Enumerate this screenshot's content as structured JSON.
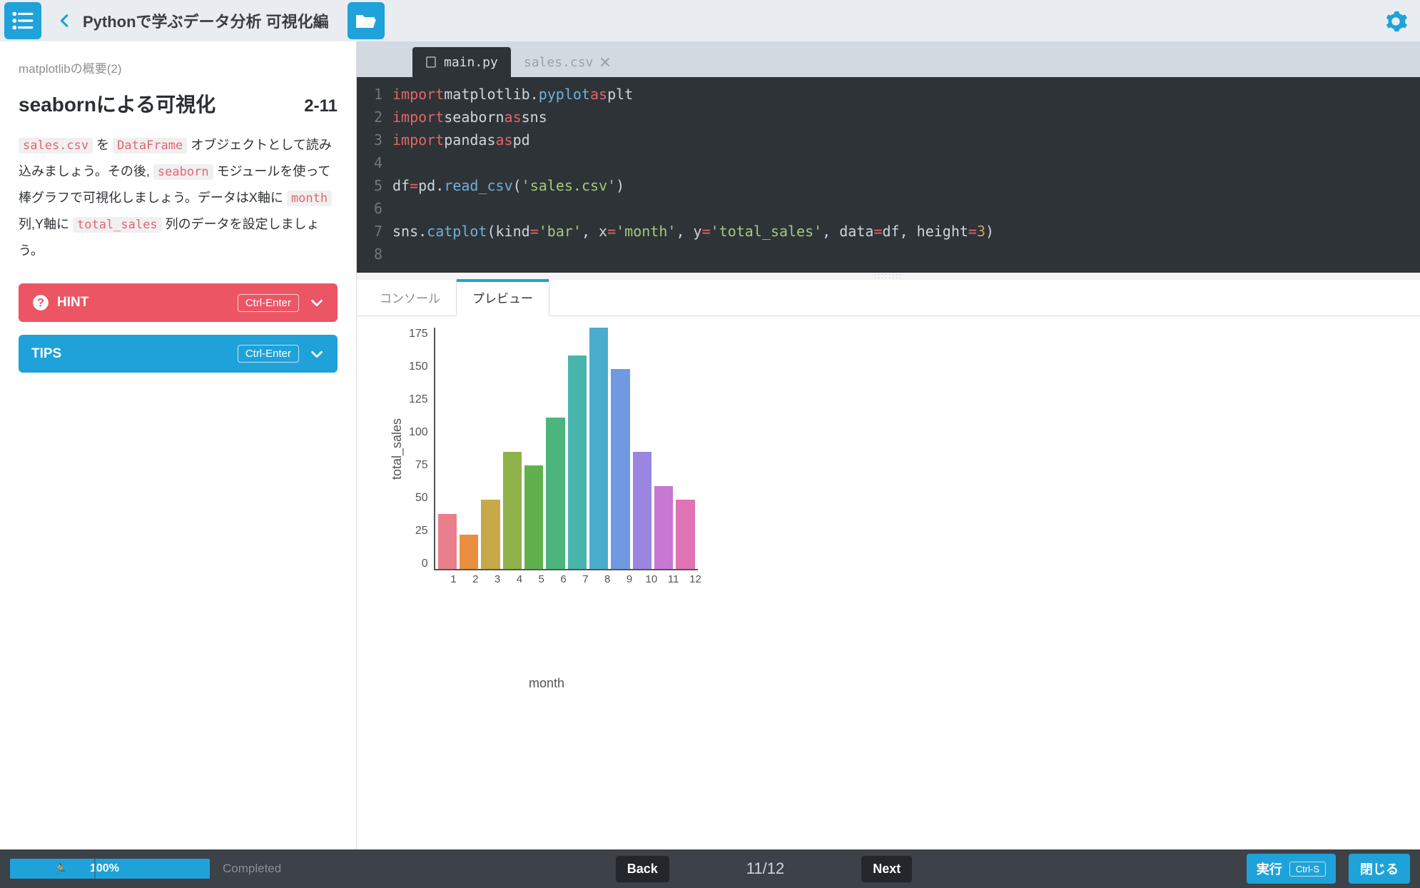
{
  "header": {
    "course_title": "Pythonで学ぶデータ分析 可視化編"
  },
  "lesson": {
    "breadcrumb": "matplotlibの概要(2)",
    "title": "seabornによる可視化",
    "number": "2-11",
    "desc_prefix1": " を ",
    "desc_prefix2": " オブジェクトとして読み込みましょう。その後, ",
    "desc_prefix3": " モジュールを使って棒グラフで可視化しましょう。データはX軸に ",
    "desc_prefix4": " 列,Y軸に ",
    "desc_prefix5": " 列のデータを設定しましょう。",
    "chips": {
      "c1": "sales.csv",
      "c2": "DataFrame",
      "c3": "seaborn",
      "c4": "month",
      "c5": "total_sales"
    }
  },
  "buttons": {
    "hint_label": "HINT",
    "hint_shortcut": "Ctrl-Enter",
    "tips_label": "TIPS",
    "tips_shortcut": "Ctrl-Enter"
  },
  "tabs": {
    "file1": "main.py",
    "file2": "sales.csv"
  },
  "code_tokens": {
    "l1": {
      "kw": "import",
      "mod": "matplotlib",
      "sub": "pyplot",
      "as": "as",
      "al": "plt"
    },
    "l2": {
      "kw": "import",
      "mod": "seaborn",
      "as": "as",
      "al": "sns"
    },
    "l3": {
      "kw": "import",
      "mod": "pandas",
      "as": "as",
      "al": "pd"
    },
    "l5": {
      "v": "df",
      "eq": "=",
      "obj": "pd",
      "fn": "read_csv",
      "arg": "'sales.csv'"
    },
    "l7": {
      "obj": "sns",
      "fn": "catplot",
      "k1": "kind",
      "v1": "'bar'",
      "k2": "x",
      "v2": "'month'",
      "k3": "y",
      "v3": "'total_sales'",
      "k4": "data",
      "v4": "df",
      "k5": "height",
      "v5": "3"
    },
    "gut": {
      "1": "1",
      "2": "2",
      "3": "3",
      "4": "4",
      "5": "5",
      "6": "6",
      "7": "7",
      "8": "8"
    }
  },
  "output_tabs": {
    "console": "コンソール",
    "preview": "プレビュー"
  },
  "chart_data": {
    "type": "bar",
    "categories": [
      "1",
      "2",
      "3",
      "4",
      "5",
      "6",
      "7",
      "8",
      "9",
      "10",
      "11",
      "12"
    ],
    "values": [
      40,
      25,
      50,
      85,
      75,
      110,
      155,
      175,
      145,
      85,
      60,
      50
    ],
    "colors": [
      "#e97f8d",
      "#e8903f",
      "#c7a94a",
      "#8fb24a",
      "#60b14e",
      "#4bb57d",
      "#47b5ab",
      "#4aadce",
      "#6f99e0",
      "#9a85e0",
      "#c877d2",
      "#e073b4"
    ],
    "title": "",
    "xlabel": "month",
    "ylabel": "total_sales",
    "ylim": [
      0,
      175
    ],
    "yticks": [
      "0",
      "25",
      "50",
      "75",
      "100",
      "125",
      "150",
      "175"
    ]
  },
  "footer": {
    "percent": "100%",
    "completed": "Completed",
    "back": "Back",
    "next": "Next",
    "page": "11/12",
    "run": "実行",
    "run_shortcut": "Ctrl-S",
    "close": "閉じる"
  }
}
